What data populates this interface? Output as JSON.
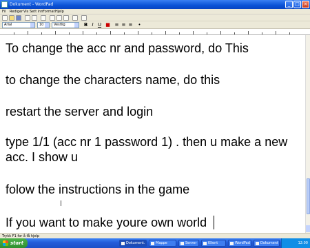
{
  "window": {
    "title": "Dokument - WordPad"
  },
  "menu": {
    "items": [
      "Fil",
      "Rediger",
      "Vis",
      "Sett inn",
      "Format",
      "Hjelp"
    ]
  },
  "format_bar": {
    "font": "Arial",
    "size": "10",
    "script": "Vestlig"
  },
  "document": {
    "lines": [
      "To change the acc nr and password, do This",
      "to change the characters name, do this",
      "restart the server and login",
      "type 1/1 (acc nr 1 password 1) . then u make a new",
      "acc. I show u",
      "folow the instructions in the game",
      "If you want to make youre own world"
    ]
  },
  "statusbar": {
    "text": "Trykk F1 for å få hjelp"
  },
  "taskbar": {
    "start_label": "start",
    "tasks": [
      "Dokument...",
      "Mappe",
      "Server",
      "Klient",
      "WordPad",
      "Dokument"
    ],
    "clock": "12:00"
  },
  "icons": {
    "toolbar": [
      "new-icon",
      "open-icon",
      "save-icon",
      "print-icon",
      "print-preview-icon",
      "find-icon",
      "cut-icon",
      "copy-icon",
      "paste-icon",
      "undo-icon",
      "date-time-icon"
    ]
  }
}
